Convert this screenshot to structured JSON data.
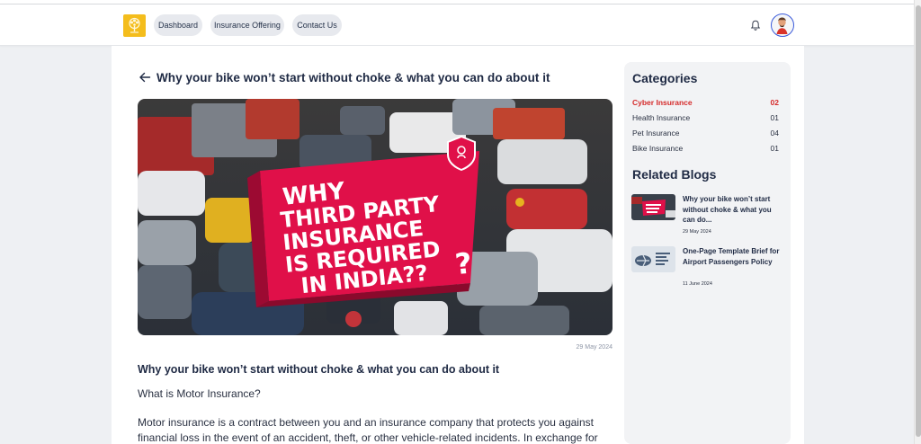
{
  "nav": {
    "items": [
      {
        "label": "Dashboard"
      },
      {
        "label": "Insurance Offering"
      },
      {
        "label": "Contact Us"
      }
    ],
    "icons": {
      "logo": "tree-logo-icon",
      "notifications": "bell-icon",
      "profile": "avatar"
    },
    "logo_color": "#f4bd1c"
  },
  "post": {
    "back_icon": "arrow-left-icon",
    "title": "Why your bike won’t start without choke & what you can do about it",
    "hero_text": [
      "WHY",
      "THIRD PARTY",
      "INSURANCE",
      "IS REQUIRED",
      "IN INDIA??",
      "?"
    ],
    "date": "29 May 2024",
    "heading": "Why your bike won’t start without choke & what you can do about it",
    "subheading": "What is Motor Insurance?",
    "paragraph": "Motor insurance is a contract between you and an insurance company that protects you against financial loss in the event of an accident, theft, or other vehicle-related incidents. In exchange for"
  },
  "sidebar": {
    "categories_heading": "Categories",
    "categories": [
      {
        "name": "Cyber Insurance",
        "count": "02",
        "active": true
      },
      {
        "name": "Health Insurance",
        "count": "01",
        "active": false
      },
      {
        "name": "Pet Insurance",
        "count": "04",
        "active": false
      },
      {
        "name": "Bike Insurance",
        "count": "01",
        "active": false
      }
    ],
    "related_heading": "Related Blogs",
    "related": [
      {
        "title": "Why your bike won’t start without choke & what you can do...",
        "date": "29 May 2024"
      },
      {
        "title": "One-Page Template Brief for Airport Passengers Policy",
        "date": "11 June 2024"
      }
    ],
    "active_color": "#d52b2b"
  }
}
